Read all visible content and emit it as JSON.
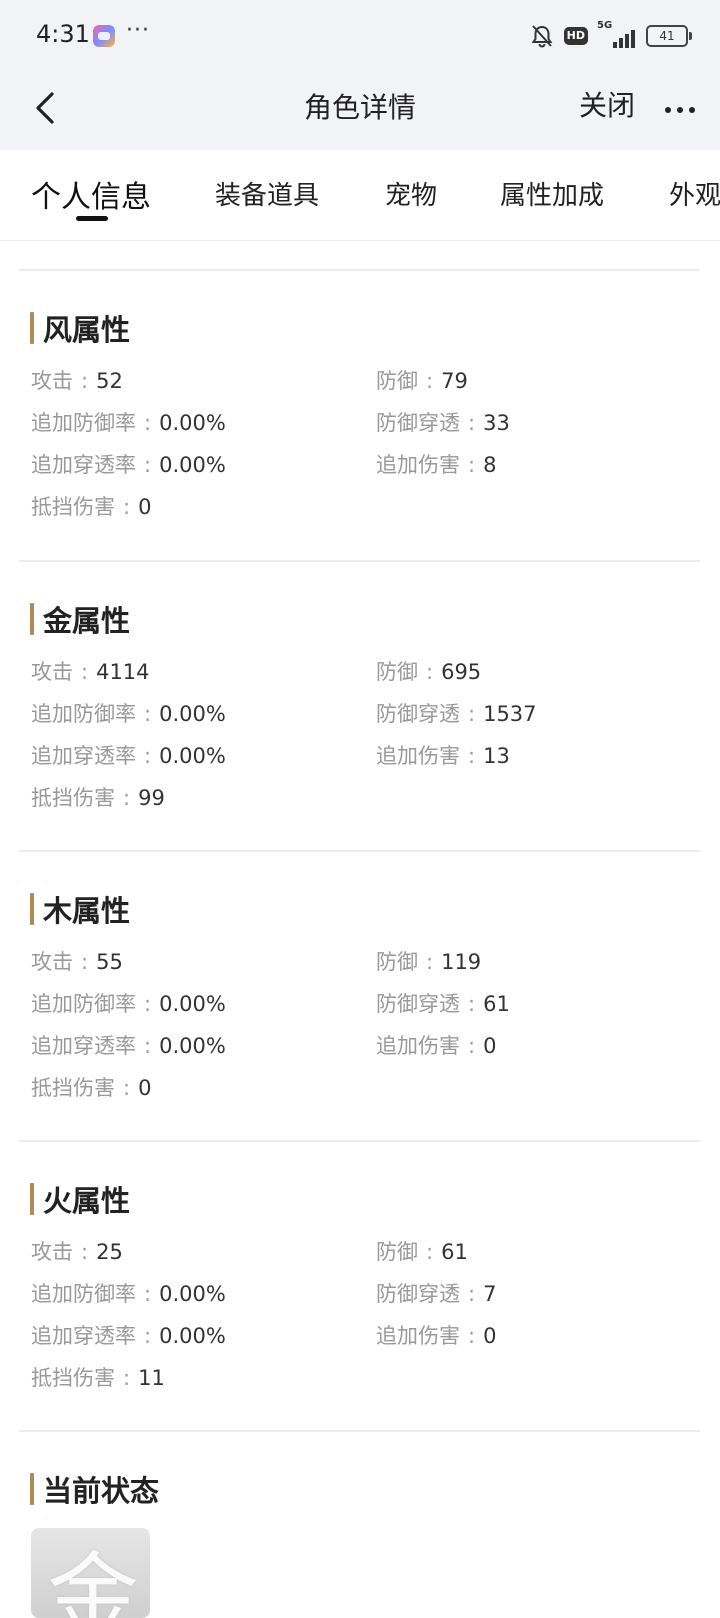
{
  "status_bar": {
    "time": "4:31",
    "network": "5G",
    "battery": "41",
    "hd": "HD"
  },
  "nav": {
    "title": "角色详情",
    "close_label": "关闭"
  },
  "tabs": [
    {
      "label": "个人信息",
      "active": true
    },
    {
      "label": "装备道具"
    },
    {
      "label": "宠物"
    },
    {
      "label": "属性加成"
    },
    {
      "label": "外观"
    }
  ],
  "sections": [
    {
      "title": "风属性",
      "stats": [
        {
          "label": "攻击",
          "value": "52"
        },
        {
          "label": "防御",
          "value": "79"
        },
        {
          "label": "追加防御率",
          "value": "0.00%"
        },
        {
          "label": "防御穿透",
          "value": "33"
        },
        {
          "label": "追加穿透率",
          "value": "0.00%"
        },
        {
          "label": "追加伤害",
          "value": "8"
        },
        {
          "label": "抵挡伤害",
          "value": "0"
        }
      ]
    },
    {
      "title": "金属性",
      "stats": [
        {
          "label": "攻击",
          "value": "4114"
        },
        {
          "label": "防御",
          "value": "695"
        },
        {
          "label": "追加防御率",
          "value": "0.00%"
        },
        {
          "label": "防御穿透",
          "value": "1537"
        },
        {
          "label": "追加穿透率",
          "value": "0.00%"
        },
        {
          "label": "追加伤害",
          "value": "13"
        },
        {
          "label": "抵挡伤害",
          "value": "99"
        }
      ]
    },
    {
      "title": "木属性",
      "stats": [
        {
          "label": "攻击",
          "value": "55"
        },
        {
          "label": "防御",
          "value": "119"
        },
        {
          "label": "追加防御率",
          "value": "0.00%"
        },
        {
          "label": "防御穿透",
          "value": "61"
        },
        {
          "label": "追加穿透率",
          "value": "0.00%"
        },
        {
          "label": "追加伤害",
          "value": "0"
        },
        {
          "label": "抵挡伤害",
          "value": "0"
        }
      ]
    },
    {
      "title": "火属性",
      "stats": [
        {
          "label": "攻击",
          "value": "25"
        },
        {
          "label": "防御",
          "value": "61"
        },
        {
          "label": "追加防御率",
          "value": "0.00%"
        },
        {
          "label": "防御穿透",
          "value": "7"
        },
        {
          "label": "追加穿透率",
          "value": "0.00%"
        },
        {
          "label": "追加伤害",
          "value": "0"
        },
        {
          "label": "抵挡伤害",
          "value": "11"
        }
      ]
    }
  ],
  "current_status": {
    "title": "当前状态",
    "icon_glyph": "金"
  },
  "colors": {
    "accent_bar": "#b08a5a",
    "header_bg": "#f2f3f7",
    "label": "#999999"
  }
}
